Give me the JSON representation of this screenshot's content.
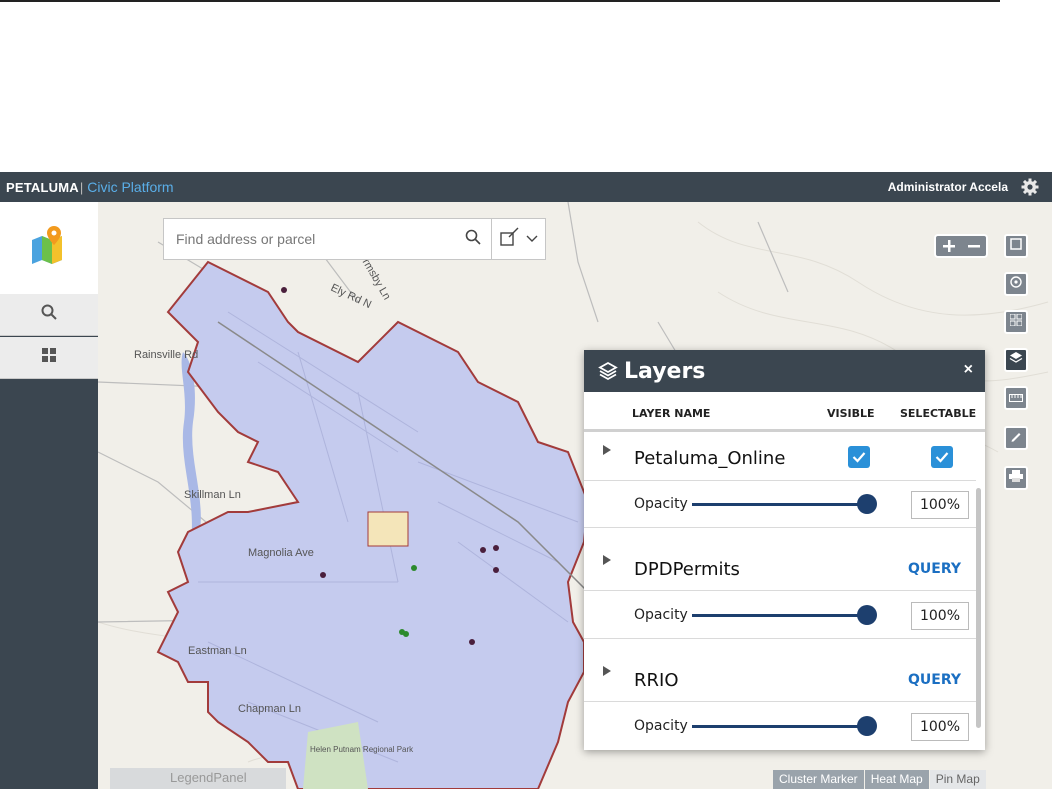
{
  "header": {
    "brand": "PETALUMA",
    "brand_separator": "|",
    "product": "Civic Platform",
    "user": "Administrator Accela"
  },
  "sidebar": {
    "items": [
      {
        "icon": "map-pin-icon"
      },
      {
        "icon": "search-icon"
      },
      {
        "icon": "grid-icon"
      }
    ]
  },
  "search": {
    "placeholder": "Find address or parcel",
    "value": ""
  },
  "map": {
    "labels": [
      "Rainsville Rd",
      "Skillman Ln",
      "Magnolia Ave",
      "Eastman Ln",
      "Chapman Ln",
      "Ely Rd N",
      "Ormsby Ln",
      "Helen Putnam Regional Park"
    ]
  },
  "layers_panel": {
    "title": "Layers",
    "close": "×",
    "columns": {
      "name": "LAYER NAME",
      "visible": "VISIBLE",
      "selectable": "SELECTABLE"
    },
    "layers": [
      {
        "name": "Petaluma_Online",
        "visible": true,
        "selectable": true,
        "opacity_label": "Opacity",
        "opacity": "100%"
      },
      {
        "name": "DPDPermits",
        "action": "QUERY",
        "opacity_label": "Opacity",
        "opacity": "100%"
      },
      {
        "name": "RRIO",
        "action": "QUERY",
        "opacity_label": "Opacity",
        "opacity": "100%"
      }
    ]
  },
  "map_controls": {
    "bottom_tabs": [
      "Cluster Marker",
      "Heat Map",
      "Pin Map"
    ],
    "legend_panel": "LegendPanel"
  },
  "colors": {
    "header_bg": "#3b4650",
    "accent": "#2a90d8",
    "city_fill": "#c5cbee",
    "city_border": "#a23b3b"
  }
}
